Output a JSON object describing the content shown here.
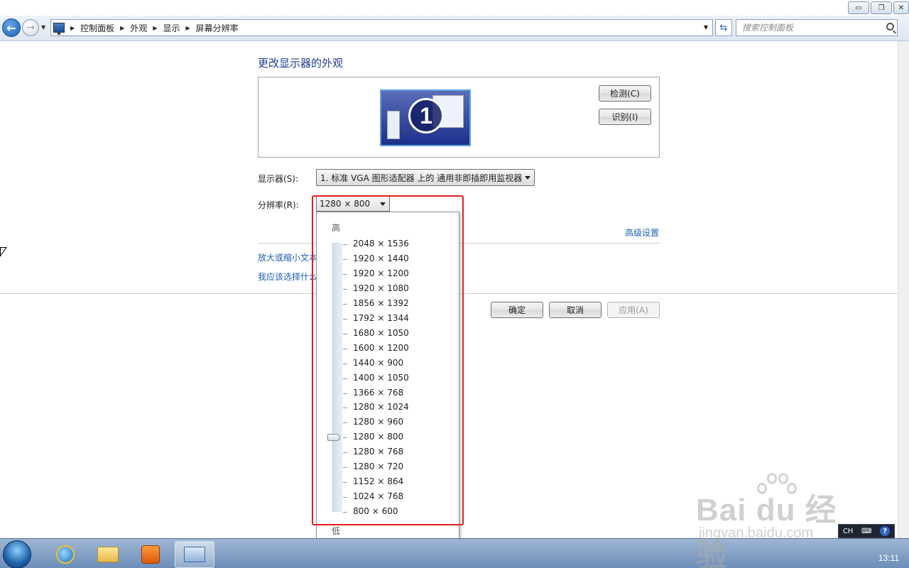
{
  "window": {
    "minimize_icon": "minimize-icon",
    "maximize_icon": "restore-icon",
    "close_icon": "close-icon"
  },
  "address_bar": {
    "breadcrumbs": [
      "控制面板",
      "外观",
      "显示",
      "屏幕分辨率"
    ],
    "search_placeholder": "搜索控制面板"
  },
  "main": {
    "title": "更改显示器的外观",
    "monitor_number": "1",
    "detect_button": "检测(C)",
    "identify_button": "识别(I)",
    "display_label": "显示器(S):",
    "display_value": "1. 标准 VGA 图形适配器 上的 通用非即插即用监视器",
    "resolution_label": "分辨率(R):",
    "resolution_value": "1280 × 800",
    "advanced_link": "高级设置",
    "link_text_size": "放大或缩小文本",
    "link_which_settings": "我应该选择什么",
    "ok_button": "确定",
    "cancel_button": "取消",
    "apply_button": "应用(A)"
  },
  "resolution_dropdown": {
    "high_label": "高",
    "low_label": "低",
    "options": [
      "2048 × 1536",
      "1920 × 1440",
      "1920 × 1200",
      "1920 × 1080",
      "1856 × 1392",
      "1792 × 1344",
      "1680 × 1050",
      "1600 × 1200",
      "1440 × 900",
      "1400 × 1050",
      "1366 × 768",
      "1280 × 1024",
      "1280 × 960",
      "1280 × 800",
      "1280 × 768",
      "1280 × 720",
      "1152 × 864",
      "1024 × 768",
      "800 × 600"
    ],
    "selected_index": 13
  },
  "taskbar": {
    "language": "CH",
    "clock": "13:11"
  },
  "watermark": {
    "brand": "Bai du 经验",
    "url": "jingyan.baidu.com"
  },
  "colors": {
    "link": "#1f5fb0",
    "title": "#1e3d8f",
    "highlight": "#e02020"
  }
}
